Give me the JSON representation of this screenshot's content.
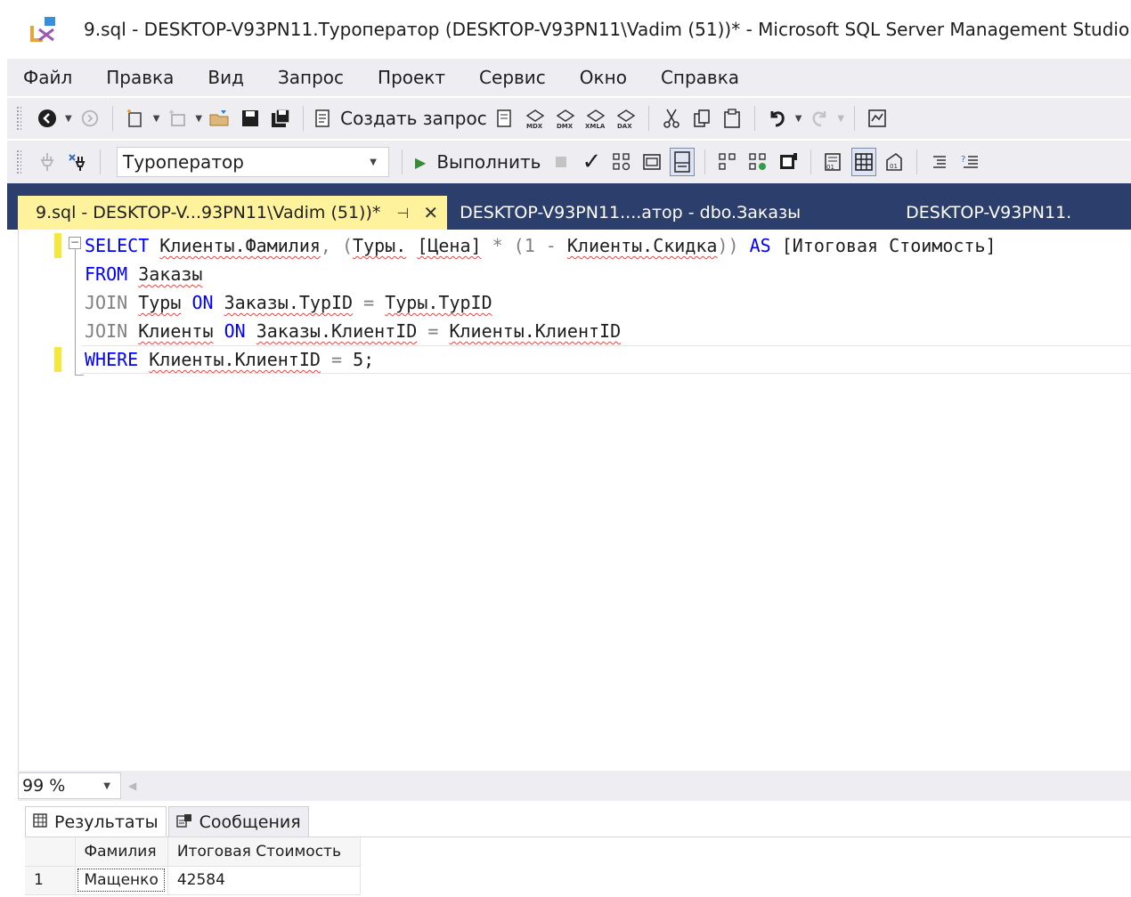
{
  "window": {
    "title": "9.sql - DESKTOP-V93PN11.Туроператор (DESKTOP-V93PN11\\Vadim (51))* - Microsoft SQL Server Management Studio"
  },
  "menu": [
    "Файл",
    "Правка",
    "Вид",
    "Запрос",
    "Проект",
    "Сервис",
    "Окно",
    "Справка"
  ],
  "toolbar": {
    "new_query_label": "Создать запрос",
    "database": "Туроператор",
    "execute_label": "Выполнить"
  },
  "tabs": [
    {
      "label": "9.sql - DESKTOP-V...93PN11\\Vadim (51))*",
      "active": true
    },
    {
      "label": "DESKTOP-V93PN11....атор - dbo.Заказы",
      "active": false
    },
    {
      "label": "DESKTOP-V93PN11.",
      "active": false
    }
  ],
  "editor": {
    "lines": [
      {
        "kw1": "SELECT",
        "t1": "Клиенты.Фамилия",
        "t2": ", (",
        "t3": "Туры.",
        "t4": " ",
        "t5": "[Цена]",
        "t6": " * (1 - ",
        "t7": "Клиенты.Скидка",
        "t8": ")) ",
        "kw2": "AS",
        "t9": " [Итоговая Стоимость]"
      },
      {
        "kw1": "FROM",
        "t1": "Заказы"
      },
      {
        "kw1": "JOIN",
        "t1": "Туры",
        "kw2": "ON",
        "t2": "Заказы.ТурID",
        "op": "=",
        "t3": "Туры.ТурID"
      },
      {
        "kw1": "JOIN",
        "t1": "Клиенты",
        "kw2": "ON",
        "t2": "Заказы.КлиентID",
        "op": "=",
        "t3": "Клиенты.КлиентID"
      },
      {
        "kw1": "WHERE",
        "t1": "Клиенты.КлиентID",
        "op": "=",
        "t2": "5;"
      }
    ]
  },
  "zoom": {
    "value": "99 %"
  },
  "results": {
    "tabs": [
      "Результаты",
      "Сообщения"
    ],
    "columns": [
      "Фамилия",
      "Итоговая Стоимость"
    ],
    "rows": [
      {
        "num": "1",
        "cells": [
          "Мащенко",
          "42584"
        ]
      }
    ]
  }
}
